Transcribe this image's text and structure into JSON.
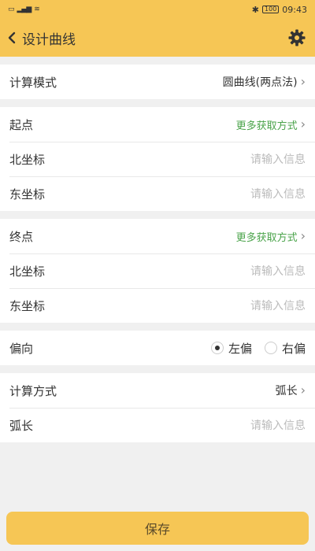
{
  "status_bar": {
    "left_icons": "sim-signal-wifi",
    "time": "09:43",
    "battery": "100"
  },
  "header": {
    "title": "设计曲线",
    "back_icon": "chevron-left-icon",
    "settings_icon": "gear-icon"
  },
  "mode": {
    "label": "计算模式",
    "value": "圆曲线(两点法)"
  },
  "start": {
    "label": "起点",
    "more": "更多获取方式",
    "north_label": "北坐标",
    "north_placeholder": "请输入信息",
    "east_label": "东坐标",
    "east_placeholder": "请输入信息"
  },
  "end": {
    "label": "终点",
    "more": "更多获取方式",
    "north_label": "北坐标",
    "north_placeholder": "请输入信息",
    "east_label": "东坐标",
    "east_placeholder": "请输入信息"
  },
  "direction": {
    "label": "偏向",
    "options": [
      "左偏",
      "右偏"
    ],
    "selected": "左偏"
  },
  "method": {
    "label": "计算方式",
    "value": "弧长"
  },
  "arc": {
    "label": "弧长",
    "placeholder": "请输入信息"
  },
  "footer": {
    "save_label": "保存"
  },
  "colors": {
    "accent": "#f6c655",
    "link_green": "#4aa34a"
  }
}
